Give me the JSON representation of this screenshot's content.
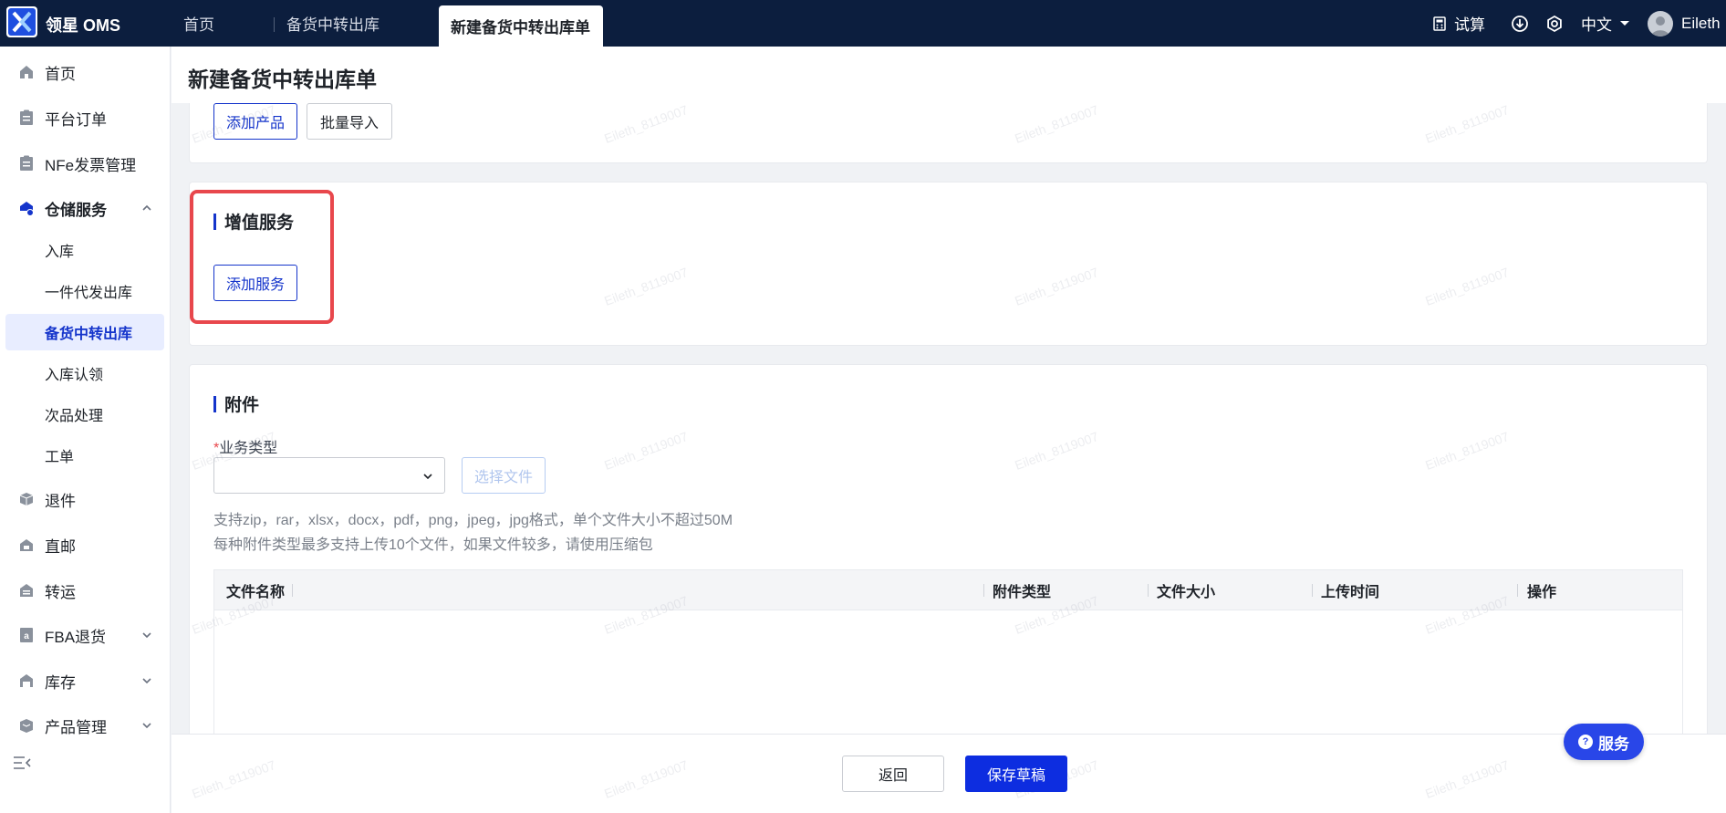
{
  "app": {
    "brand": "领星 OMS"
  },
  "tabs": [
    {
      "label": "首页"
    },
    {
      "label": "备货中转出库"
    },
    {
      "label": "新建备货中转出库单"
    }
  ],
  "topbar": {
    "calc_label": "试算",
    "lang_label": "中文",
    "user_name": "Eileth"
  },
  "sidebar": {
    "items": [
      {
        "label": "首页",
        "icon": "home-icon"
      },
      {
        "label": "平台订单",
        "icon": "clipboard-icon"
      },
      {
        "label": "NFe发票管理",
        "icon": "clipboard-icon"
      },
      {
        "label": "仓储服务",
        "icon": "warehouse-icon",
        "expanded": true
      },
      {
        "label": "退件",
        "icon": "return-box-icon"
      },
      {
        "label": "直邮",
        "icon": "direct-mail-icon"
      },
      {
        "label": "转运",
        "icon": "transfer-icon"
      },
      {
        "label": "FBA退货",
        "icon": "fba-return-icon"
      },
      {
        "label": "库存",
        "icon": "inventory-icon"
      },
      {
        "label": "产品管理",
        "icon": "product-icon"
      }
    ],
    "sub_items": [
      {
        "label": "入库"
      },
      {
        "label": "一件代发出库"
      },
      {
        "label": "备货中转出库",
        "active": true
      },
      {
        "label": "入库认领"
      },
      {
        "label": "次品处理"
      },
      {
        "label": "工单"
      }
    ]
  },
  "page": {
    "title": "新建备货中转出库单",
    "add_product_label": "添加产品",
    "batch_import_label": "批量导入",
    "service_section_title": "增值服务",
    "add_service_label": "添加服务",
    "attach_section_title": "附件",
    "business_type_label": "业务类型",
    "required_mark": "*",
    "select_file_label": "选择文件",
    "hint_line1": "支持zip，rar，xlsx，docx，pdf，png，jpeg，jpg格式，单个文件大小不超过50M",
    "hint_line2": "每种附件类型最多支持上传10个文件，如果文件较多，请使用压缩包",
    "table_headers": [
      "文件名称",
      "附件类型",
      "文件大小",
      "上传时间",
      "操作"
    ]
  },
  "footer": {
    "back_label": "返回",
    "save_draft_label": "保存草稿"
  },
  "float_service": {
    "label": "服务"
  },
  "watermark": "Eileth_8119007",
  "colors": {
    "topbar": "#0c1e3e",
    "accent": "#1434cb",
    "highlight": "#e8474c"
  }
}
